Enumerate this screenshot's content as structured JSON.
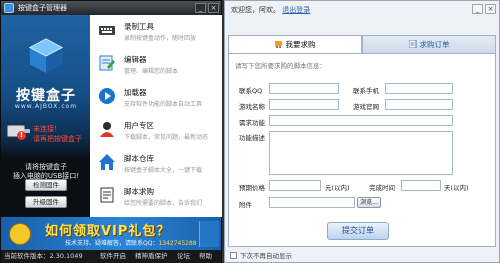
{
  "left_window": {
    "title": "按键盒子管理器",
    "controls": {
      "minimize": "_",
      "close": "×"
    },
    "logo": {
      "text": "按键盒子",
      "url": "www.AJBOX.com"
    },
    "status": {
      "line1": "未连接！",
      "line2": "请再把按键盒子"
    },
    "insert_tip": {
      "line1": "请将按键盒子",
      "line2": "插入电脑的USB接口!"
    },
    "buttons": {
      "detect": "检测固件",
      "upgrade": "升级固件"
    },
    "menu": [
      {
        "title": "录制工具",
        "desc": "录制按键盒动作，随时回放",
        "icon": "keyboard-icon"
      },
      {
        "title": "编辑器",
        "desc": "管理、编辑您的脚本",
        "icon": "editor-icon"
      },
      {
        "title": "加载器",
        "desc": "支持软件功能的脚本自动工具",
        "icon": "loader-icon"
      },
      {
        "title": "用户专区",
        "desc": "下载脚本，常见问题，最新动态",
        "icon": "user-icon"
      },
      {
        "title": "脚本仓库",
        "desc": "按键盒子脚本大全，一键下载",
        "icon": "house-icon"
      },
      {
        "title": "脚本求购",
        "desc": "给您所需要的脚本，告诉我们",
        "icon": "script-icon"
      }
    ],
    "vip_banner": {
      "headline": "如何领取VIP礼包？",
      "sub_prefix": "技术支持、疑难解答，请联系QQ：",
      "qq": "1342745288"
    },
    "bottom_bar": {
      "version": "当前软件版本：2.30.1049",
      "links": [
        "软件开启",
        "精神盾保护",
        "论坛",
        "帮助"
      ]
    }
  },
  "right_window": {
    "welcome": "欢迎您，阿欢。",
    "logout_link": "退出登录",
    "controls": {
      "minimize": "_",
      "close": "×"
    },
    "tabs": [
      {
        "label": "我要求购",
        "active": true,
        "icon": "cart-icon"
      },
      {
        "label": "求购订单",
        "active": false,
        "icon": "list-icon"
      }
    ],
    "form": {
      "hint": "请写下您所要求购的脚本信息：",
      "qq_label": "联系QQ",
      "phone_label": "联系手机",
      "game_label": "游戏名称",
      "server_label": "游戏官网",
      "feature_label": "需求功能",
      "desc_label": "功能描述",
      "budget_label": "预期价格",
      "budget_unit": "元(以内)",
      "deadline_label": "完成时间",
      "deadline_unit": "天(以内)",
      "attach_label": "附件",
      "browse": "浏览...",
      "submit": "提交订单"
    },
    "footer_checkbox": "下次不再自动显示"
  },
  "colors": {
    "left_bg": "#111417",
    "sidebar_blue": "#1f63a3",
    "banner_blue": "#2a86d8",
    "vip_yellow": "#ffe44a",
    "link_blue": "#2a5db0",
    "status_red": "#ff4a3a"
  }
}
